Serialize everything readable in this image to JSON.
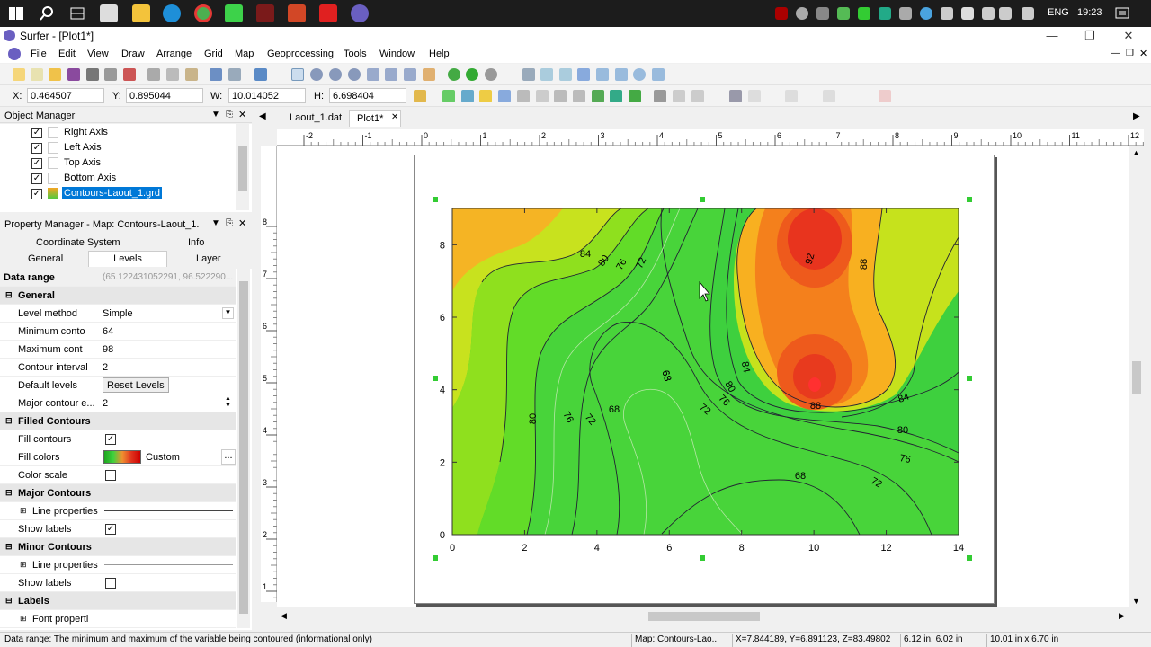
{
  "taskbar": {
    "language": "ENG",
    "time": "19:23"
  },
  "window": {
    "title": "Surfer - [Plot1*]"
  },
  "menu": [
    "File",
    "Edit",
    "View",
    "Draw",
    "Arrange",
    "Grid",
    "Map",
    "Geoprocessing",
    "Tools",
    "Window",
    "Help"
  ],
  "coords": {
    "x_label": "X:",
    "x": "0.464507",
    "y_label": "Y:",
    "y": "0.895044",
    "w_label": "W:",
    "w": "10.014052",
    "h_label": "H:",
    "h": "6.698404"
  },
  "object_manager": {
    "title": "Object Manager",
    "items": [
      {
        "label": "Right Axis",
        "checked": true
      },
      {
        "label": "Left Axis",
        "checked": true
      },
      {
        "label": "Top Axis",
        "checked": true
      },
      {
        "label": "Bottom Axis",
        "checked": true
      },
      {
        "label": "Contours-Laout_1.grd",
        "checked": true,
        "selected": true
      }
    ]
  },
  "property_manager": {
    "title": "Property Manager - Map: Contours-Laout_1.",
    "tabs_row1": [
      "Coordinate System",
      "Info"
    ],
    "tabs_row2": [
      "General",
      "Levels",
      "Layer"
    ],
    "active_tab": "Levels",
    "data_range_label": "Data range",
    "data_range_value": "(65.122431052291, 96.522290...",
    "rows": [
      {
        "type": "section",
        "label": "General"
      },
      {
        "type": "row",
        "label": "Level method",
        "value": "Simple",
        "dropdown": true
      },
      {
        "type": "row",
        "label": "Minimum conto",
        "value": "64"
      },
      {
        "type": "row",
        "label": "Maximum cont",
        "value": "98"
      },
      {
        "type": "row",
        "label": "Contour interval",
        "value": "2"
      },
      {
        "type": "row",
        "label": "Default levels",
        "value": "Reset Levels",
        "button": true
      },
      {
        "type": "row",
        "label": "Major contour e...",
        "value": "2",
        "spinner": true
      },
      {
        "type": "section",
        "label": "Filled Contours"
      },
      {
        "type": "row",
        "label": "Fill contours",
        "check": true
      },
      {
        "type": "row",
        "label": "Fill colors",
        "value": "Custom",
        "gradient": true
      },
      {
        "type": "row",
        "label": "Color scale",
        "check": false
      },
      {
        "type": "section",
        "label": "Major Contours"
      },
      {
        "type": "row",
        "label": "Line properties",
        "expand": true,
        "line": true
      },
      {
        "type": "row",
        "label": "Show labels",
        "check": true
      },
      {
        "type": "section",
        "label": "Minor Contours"
      },
      {
        "type": "row",
        "label": "Line properties",
        "expand": true,
        "line": true
      },
      {
        "type": "row",
        "label": "Show labels",
        "check": false
      },
      {
        "type": "section",
        "label": "Labels"
      },
      {
        "type": "row",
        "label": "Font properti",
        "expand": true
      }
    ]
  },
  "doc_tabs": [
    {
      "label": "Laout_1.dat",
      "active": false
    },
    {
      "label": "Plot1*",
      "active": true
    }
  ],
  "map": {
    "x_ticks": [
      "0",
      "2",
      "4",
      "6",
      "8",
      "10",
      "12",
      "14"
    ],
    "y_ticks": [
      "0",
      "2",
      "4",
      "6",
      "8"
    ],
    "contour_labels": [
      "84",
      "80",
      "76",
      "72",
      "68",
      "68",
      "72",
      "76",
      "80",
      "84",
      "80",
      "76",
      "72",
      "68",
      "88",
      "92",
      "88",
      "84",
      "80",
      "76",
      "72",
      "68"
    ]
  },
  "h_ruler_ticks": [
    "-2",
    "-1",
    "0",
    "1",
    "2",
    "3",
    "4",
    "5",
    "6",
    "7",
    "8",
    "9",
    "10",
    "11",
    "12"
  ],
  "v_ruler_ticks": [
    "8",
    "7",
    "6",
    "5",
    "4",
    "3",
    "2",
    "1"
  ],
  "status": {
    "message": "Data range: The minimum and maximum of the variable being contoured (informational only)",
    "object": "Map: Contours-Lao...",
    "cursor": "X=7.844189, Y=6.891123, Z=83.49802",
    "size1": "6.12 in, 6.02 in",
    "size2": "10.01 in x 6.70 in"
  },
  "colors": {
    "taskbar": "#1c1c1c",
    "selection": "#0078d7",
    "green": "#33cc33",
    "orange": "#f08c1e",
    "red": "#e0341e"
  }
}
